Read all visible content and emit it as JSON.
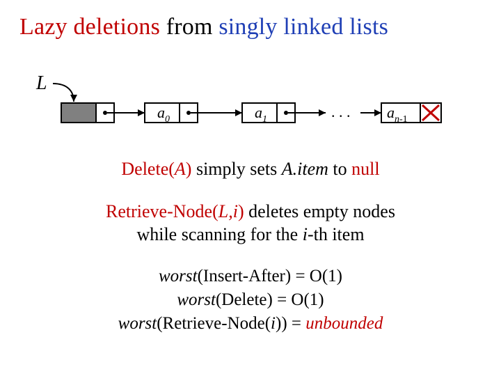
{
  "title": {
    "p1": "Lazy deletions",
    "p2": " from ",
    "p3": "singly linked lists"
  },
  "list": {
    "L": "L",
    "a0_base": "a",
    "a0_sub": "0",
    "a1_base": "a",
    "a1_sub": "1",
    "dots": ". . .",
    "an_base": "a",
    "an_sub_i": "n",
    "an_sub_t": "-1"
  },
  "line1": {
    "p1": "Delete(",
    "p2": "A",
    "p3": ")",
    "p4": " simply sets ",
    "p5": "A.",
    "p6": "item",
    "p7": " to ",
    "p8": "null"
  },
  "line2": {
    "p1": "Retrieve-Node(",
    "p2": "L,",
    "p3": "i",
    "p4": ")",
    "p5": " deletes empty nodes",
    "br": " ",
    "p6": "while scanning for the ",
    "p7": "i",
    "p8": "-th item"
  },
  "line3": {
    "w": "worst",
    "r1a": "(Insert-After) = O(1)",
    "r2a": "(Delete) = O(1)",
    "r3a": "(Retrieve-Node(",
    "r3i": "i",
    "r3b": ")) = ",
    "r3u": "unbounded"
  },
  "chart_data": {
    "type": "table",
    "title": "worst-case complexities",
    "series": [
      {
        "name": "Insert-After",
        "values": [
          "O(1)"
        ]
      },
      {
        "name": "Delete",
        "values": [
          "O(1)"
        ]
      },
      {
        "name": "Retrieve-Node(i)",
        "values": [
          "unbounded"
        ]
      }
    ]
  }
}
